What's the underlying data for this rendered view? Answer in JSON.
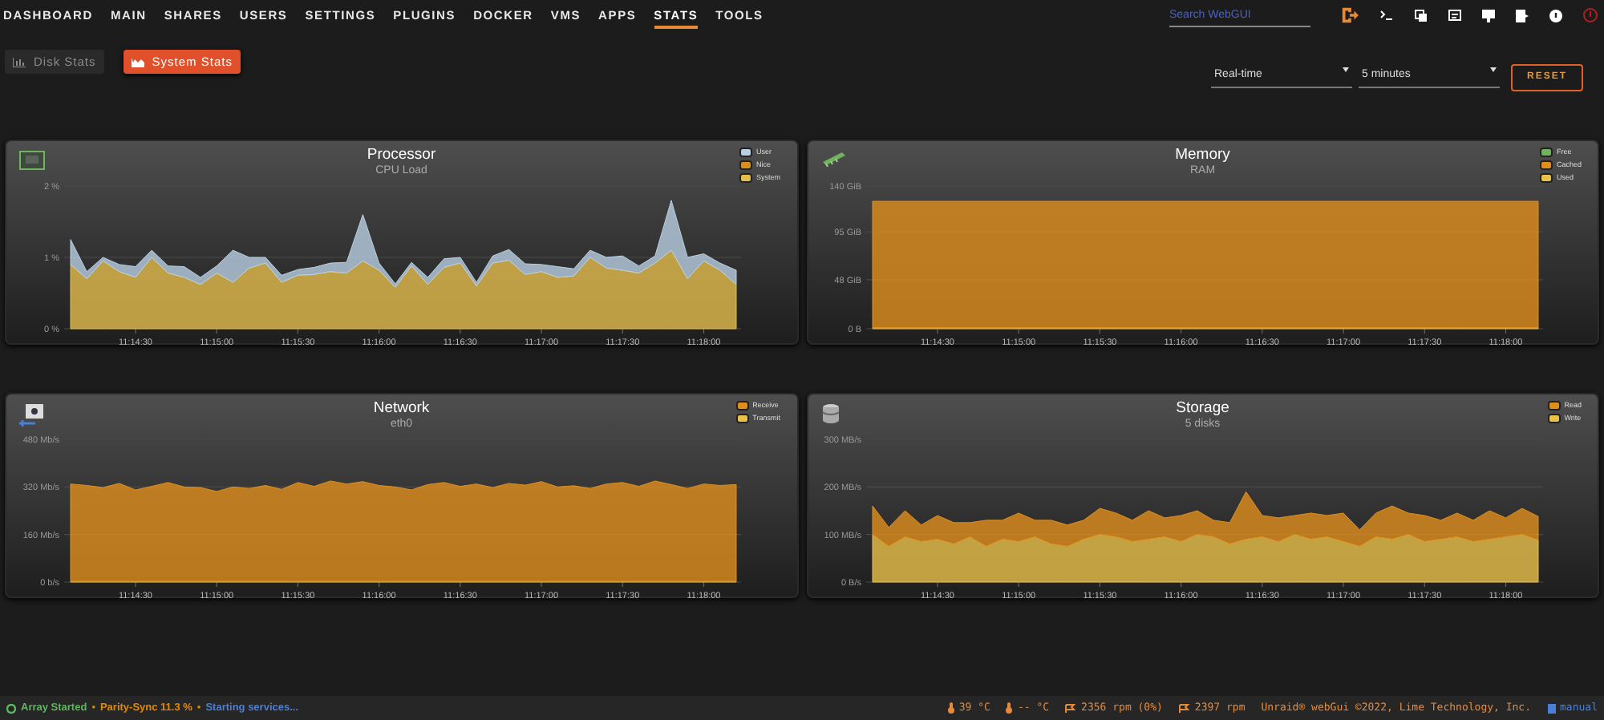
{
  "nav": {
    "items": [
      {
        "label": "DASHBOARD",
        "selected": false
      },
      {
        "label": "MAIN",
        "selected": false
      },
      {
        "label": "SHARES",
        "selected": false
      },
      {
        "label": "USERS",
        "selected": false
      },
      {
        "label": "SETTINGS",
        "selected": false
      },
      {
        "label": "PLUGINS",
        "selected": false
      },
      {
        "label": "DOCKER",
        "selected": false
      },
      {
        "label": "VMS",
        "selected": false
      },
      {
        "label": "APPS",
        "selected": false
      },
      {
        "label": "STATS",
        "selected": true
      },
      {
        "label": "TOOLS",
        "selected": false
      }
    ],
    "search": {
      "placeholder": "Search WebGUI"
    }
  },
  "tabs": [
    {
      "label": "Disk Stats",
      "selected": false
    },
    {
      "label": "System Stats",
      "selected": true
    }
  ],
  "controls": {
    "mode": "Real-time",
    "range": "5 minutes",
    "reset": "RESET"
  },
  "panels": [
    {
      "kind": "processor",
      "title": "Processor",
      "subtitle": "CPU Load",
      "chart_data": {
        "type": "area",
        "stacked": true,
        "ylim": [
          0,
          2
        ],
        "categories": [
          null,
          null,
          null,
          null,
          "11:14:30",
          null,
          null,
          null,
          null,
          "11:15:00",
          null,
          null,
          null,
          null,
          "11:15:30",
          null,
          null,
          null,
          null,
          "11:16:00",
          null,
          null,
          null,
          null,
          "11:16:30",
          null,
          null,
          null,
          null,
          "11:17:00",
          null,
          null,
          null,
          null,
          "11:17:30",
          null,
          null,
          null,
          null,
          "11:18:00",
          null,
          null
        ],
        "yticks": [
          {
            "value": 0,
            "label": "0 %"
          },
          {
            "value": 1,
            "label": "1 %"
          },
          {
            "value": 2,
            "label": "2 %"
          }
        ],
        "series": [
          {
            "name": "System",
            "color": "#e3bd4c",
            "values": [
              0.9,
              0.7,
              0.95,
              0.8,
              0.72,
              1.0,
              0.78,
              0.72,
              0.62,
              0.78,
              0.65,
              0.85,
              0.92,
              0.65,
              0.75,
              0.76,
              0.8,
              0.78,
              0.95,
              0.82,
              0.58,
              0.88,
              0.62,
              0.86,
              0.92,
              0.6,
              0.92,
              0.96,
              0.76,
              0.8,
              0.72,
              0.74,
              1.0,
              0.85,
              0.82,
              0.78,
              0.92,
              1.1,
              0.7,
              0.95,
              0.82,
              0.62
            ]
          },
          {
            "name": "Nice",
            "color": "#d98f1e",
            "values": [
              null,
              null,
              null,
              null,
              null,
              null,
              null,
              null,
              null,
              null,
              null,
              null,
              null,
              null,
              null,
              null,
              null,
              null,
              null,
              null,
              null,
              null,
              null,
              null,
              null,
              null,
              null,
              null,
              null,
              null,
              null,
              null,
              null,
              null,
              null,
              null,
              null,
              null,
              null,
              null,
              null,
              null
            ]
          },
          {
            "name": "User",
            "color": "#b9d0e2",
            "values": [
              0.35,
              0.1,
              0.05,
              0.1,
              0.15,
              0.1,
              0.1,
              0.15,
              0.1,
              0.1,
              0.45,
              0.15,
              0.08,
              0.1,
              0.08,
              0.1,
              0.12,
              0.15,
              0.65,
              0.1,
              0.05,
              0.05,
              0.1,
              0.12,
              0.08,
              0.05,
              0.1,
              0.15,
              0.15,
              0.1,
              0.15,
              0.1,
              0.1,
              0.15,
              0.2,
              0.1,
              0.1,
              0.7,
              0.3,
              0.1,
              0.1,
              0.2
            ]
          }
        ]
      }
    },
    {
      "kind": "memory",
      "title": "Memory",
      "subtitle": "RAM",
      "chart_data": {
        "type": "area",
        "stacked": true,
        "ylim": [
          0,
          140
        ],
        "categories": [
          null,
          null,
          null,
          null,
          "11:14:30",
          null,
          null,
          null,
          null,
          "11:15:00",
          null,
          null,
          null,
          null,
          "11:15:30",
          null,
          null,
          null,
          null,
          "11:16:00",
          null,
          null,
          null,
          null,
          "11:16:30",
          null,
          null,
          null,
          null,
          "11:17:00",
          null,
          null,
          null,
          null,
          "11:17:30",
          null,
          null,
          null,
          null,
          "11:18:00",
          null,
          null
        ],
        "yticks": [
          {
            "value": 0,
            "label": "0 B"
          },
          {
            "value": 48,
            "label": "48 GiB"
          },
          {
            "value": 95,
            "label": "95 GiB"
          },
          {
            "value": 140,
            "label": "140 GiB"
          }
        ],
        "series": [
          {
            "name": "Used",
            "color": "#e8c04a",
            "values": [
              1,
              1,
              1,
              1,
              1,
              1,
              1,
              1,
              1,
              1,
              1,
              1,
              1,
              1,
              1,
              1,
              1,
              1,
              1,
              1,
              1,
              1,
              1,
              1,
              1,
              1,
              1,
              1,
              1,
              1,
              1,
              1,
              1,
              1,
              1,
              1,
              1,
              1,
              1,
              1,
              1,
              1
            ]
          },
          {
            "name": "Cached",
            "color": "#e08f1e",
            "values": [
              124,
              124,
              124,
              124,
              124,
              124,
              124,
              124,
              124,
              124,
              124,
              124,
              124,
              124,
              124,
              124,
              124,
              124,
              124,
              124,
              124,
              124,
              124,
              124,
              124,
              124,
              124,
              124,
              124,
              124,
              124,
              124,
              124,
              124,
              124,
              124,
              124,
              124,
              124,
              124,
              124,
              124
            ]
          },
          {
            "name": "Free",
            "color": "#6fb35e",
            "values": [
              null,
              null,
              null,
              null,
              null,
              null,
              null,
              null,
              null,
              null,
              null,
              null,
              null,
              null,
              null,
              null,
              null,
              null,
              null,
              null,
              null,
              null,
              null,
              null,
              null,
              null,
              null,
              null,
              null,
              null,
              null,
              null,
              null,
              null,
              null,
              null,
              null,
              null,
              null,
              null,
              null,
              null
            ]
          }
        ]
      }
    },
    {
      "kind": "network",
      "title": "Network",
      "subtitle": "eth0",
      "chart_data": {
        "type": "area",
        "stacked": true,
        "ylim": [
          0,
          480
        ],
        "categories": [
          null,
          null,
          null,
          null,
          "11:14:30",
          null,
          null,
          null,
          null,
          "11:15:00",
          null,
          null,
          null,
          null,
          "11:15:30",
          null,
          null,
          null,
          null,
          "11:16:00",
          null,
          null,
          null,
          null,
          "11:16:30",
          null,
          null,
          null,
          null,
          "11:17:00",
          null,
          null,
          null,
          null,
          "11:17:30",
          null,
          null,
          null,
          null,
          "11:18:00",
          null,
          null
        ],
        "yticks": [
          {
            "value": 0,
            "label": "0 b/s"
          },
          {
            "value": 160,
            "label": "160 Mb/s"
          },
          {
            "value": 320,
            "label": "320 Mb/s"
          },
          {
            "value": 480,
            "label": "480 Mb/s"
          }
        ],
        "series": [
          {
            "name": "Transmit",
            "color": "#e8c04a",
            "values": [
              2,
              2,
              2,
              2,
              2,
              2,
              2,
              2,
              2,
              2,
              2,
              2,
              2,
              2,
              2,
              2,
              2,
              2,
              2,
              2,
              2,
              2,
              2,
              2,
              2,
              2,
              2,
              2,
              2,
              2,
              2,
              2,
              2,
              2,
              2,
              2,
              2,
              2,
              2,
              2,
              2,
              2
            ]
          },
          {
            "name": "Receive",
            "color": "#e08f1e",
            "values": [
              328,
              323,
              316,
              330,
              308,
              320,
              333,
              318,
              316,
              303,
              318,
              313,
              323,
              310,
              333,
              320,
              338,
              328,
              336,
              323,
              318,
              308,
              326,
              333,
              320,
              328,
              316,
              330,
              324,
              336,
              318,
              322,
              313,
              328,
              333,
              320,
              338,
              326,
              313,
              328,
              323,
              326
            ]
          }
        ]
      }
    },
    {
      "kind": "storage",
      "title": "Storage",
      "subtitle": "5 disks",
      "chart_data": {
        "type": "area",
        "stacked": true,
        "ylim": [
          0,
          300
        ],
        "categories": [
          null,
          null,
          null,
          null,
          "11:14:30",
          null,
          null,
          null,
          null,
          "11:15:00",
          null,
          null,
          null,
          null,
          "11:15:30",
          null,
          null,
          null,
          null,
          "11:16:00",
          null,
          null,
          null,
          null,
          "11:16:30",
          null,
          null,
          null,
          null,
          "11:17:00",
          null,
          null,
          null,
          null,
          "11:17:30",
          null,
          null,
          null,
          null,
          "11:18:00",
          null,
          null
        ],
        "yticks": [
          {
            "value": 0,
            "label": "0 B/s"
          },
          {
            "value": 100,
            "label": "100 MB/s"
          },
          {
            "value": 200,
            "label": "200 MB/s"
          },
          {
            "value": 300,
            "label": "300 MB/s"
          }
        ],
        "series": [
          {
            "name": "Write",
            "color": "#e8c04a",
            "values": [
              100,
              75,
              95,
              85,
              90,
              80,
              95,
              75,
              90,
              85,
              95,
              80,
              75,
              90,
              100,
              95,
              85,
              90,
              95,
              85,
              100,
              95,
              80,
              90,
              95,
              85,
              100,
              90,
              95,
              85,
              75,
              95,
              90,
              100,
              85,
              90,
              95,
              85,
              90,
              95,
              100,
              88
            ]
          },
          {
            "name": "Read",
            "color": "#e08f1e",
            "values": [
              60,
              40,
              55,
              35,
              50,
              45,
              30,
              55,
              40,
              60,
              35,
              50,
              45,
              40,
              55,
              50,
              45,
              60,
              40,
              55,
              50,
              35,
              45,
              100,
              45,
              50,
              40,
              55,
              45,
              60,
              35,
              50,
              70,
              45,
              55,
              40,
              50,
              45,
              60,
              40,
              55,
              50
            ]
          }
        ]
      }
    }
  ],
  "status_bar": {
    "separator": "•",
    "left": [
      {
        "text": "Array Started",
        "color": "#5cb85c",
        "kind": "array"
      },
      {
        "text": "Parity-Sync 11.3 %",
        "color": "#e68a00",
        "kind": "plain"
      },
      {
        "text": "Starting services...",
        "color": "#4a7fd6",
        "kind": "plain"
      }
    ],
    "right": [
      {
        "kind": "temp",
        "text": "39 °C"
      },
      {
        "kind": "temp",
        "text": "-- °C"
      },
      {
        "kind": "fan",
        "text": "2356 rpm (0%)"
      },
      {
        "kind": "fan",
        "text": "2397 rpm"
      },
      {
        "kind": "plain",
        "text": "Unraid® webGui ©2022, Lime Technology, Inc."
      },
      {
        "kind": "manual",
        "text": "manual"
      }
    ]
  }
}
